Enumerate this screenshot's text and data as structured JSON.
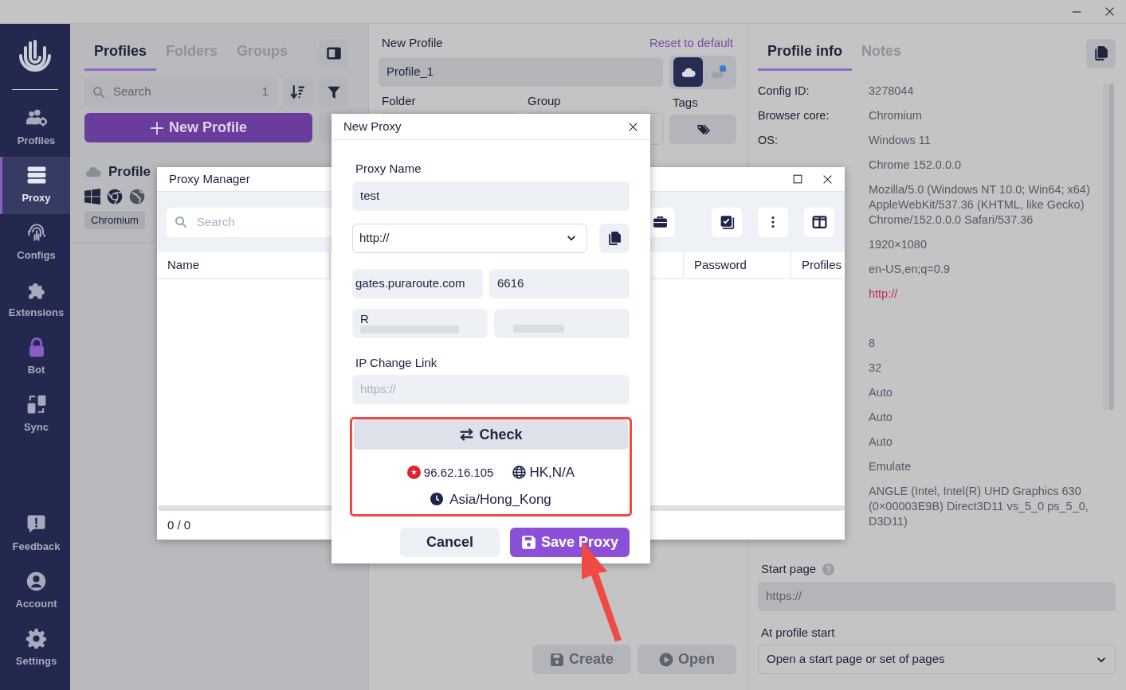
{
  "sidebar": {
    "items": [
      {
        "label": "Profiles",
        "selected": false
      },
      {
        "label": "Proxy",
        "selected": true
      },
      {
        "label": "Configs",
        "selected": false
      },
      {
        "label": "Extensions",
        "selected": false
      },
      {
        "label": "Bot",
        "selected": false
      },
      {
        "label": "Sync",
        "selected": false
      }
    ],
    "bottom_items": [
      {
        "label": "Feedback"
      },
      {
        "label": "Account"
      },
      {
        "label": "Settings"
      }
    ]
  },
  "profiles_panel": {
    "tabs": [
      {
        "label": "Profiles",
        "selected": true
      },
      {
        "label": "Folders",
        "selected": false
      },
      {
        "label": "Groups",
        "selected": false
      }
    ],
    "search": {
      "placeholder": "Search",
      "count": "1"
    },
    "new_profile_button": "New Profile",
    "profiles": [
      {
        "name": "Profile",
        "badge": "Chromium"
      }
    ]
  },
  "new_profile": {
    "title": "New Profile",
    "reset_link": "Reset to default",
    "name_value": "Profile_1",
    "storage": [
      {
        "kind": "cloud",
        "selected": true
      },
      {
        "kind": "local",
        "selected": false
      }
    ],
    "folder_label": "Folder",
    "group_label": "Group",
    "tags_label": "Tags",
    "buttons": [
      {
        "label": "Create",
        "kind": "save",
        "disabled": true
      },
      {
        "label": "Open",
        "kind": "play",
        "disabled": true
      }
    ]
  },
  "profile_info": {
    "tabs": [
      {
        "label": "Profile info",
        "selected": true
      },
      {
        "label": "Notes",
        "selected": false
      }
    ],
    "rows": [
      {
        "label": "Config ID:",
        "value": "3278044",
        "kind": "text"
      },
      {
        "label": "Browser core:",
        "value": "Chromium",
        "kind": "text"
      },
      {
        "label": "OS:",
        "value": "Windows 11",
        "kind": "text"
      },
      {
        "value": "Chrome 152.0.0.0",
        "kind": "text"
      },
      {
        "value": "Mozilla/5.0 (Windows NT 10.0; Win64; x64) AppleWebKit/537.36 (KHTML, like Gecko) Chrome/152.0.0.0 Safari/537.36",
        "kind": "text"
      },
      {
        "value": "1920×1080",
        "kind": "text"
      },
      {
        "value": "en-US,en;q=0.9",
        "kind": "text"
      },
      {
        "value": "http://",
        "kind": "link"
      }
    ],
    "more_rows": [
      "8",
      "32",
      "Auto",
      "Auto",
      "Auto",
      "Emulate",
      "ANGLE (Intel, Intel(R) UHD Graphics 630 (0×00003E9B) Direct3D11 vs_5_0 ps_5_0, D3D11)"
    ],
    "start_page": {
      "label": "Start page",
      "placeholder": "https://"
    },
    "at_profile_start": {
      "label": "At profile start",
      "value": "Open a start page or set of pages"
    }
  },
  "proxy_manager": {
    "title": "Proxy Manager",
    "search_placeholder": "Search",
    "columns": [
      "Name",
      "Password",
      "Profiles"
    ],
    "footer": "0 / 0"
  },
  "new_proxy": {
    "title": "New Proxy",
    "name_label": "Proxy Name",
    "name_value": "test",
    "type_value": "http://",
    "host_value": "gates.puraroute.com",
    "port_value": "6616",
    "login_value": "R",
    "ip_change_label": "IP Change Link",
    "ip_change_placeholder": "https://",
    "check_button": "Check",
    "result": {
      "ip": "96.62.16.105",
      "location": "HK,N/A",
      "timezone": "Asia/Hong_Kong"
    },
    "cancel_button": "Cancel",
    "save_button": "Save Proxy"
  }
}
